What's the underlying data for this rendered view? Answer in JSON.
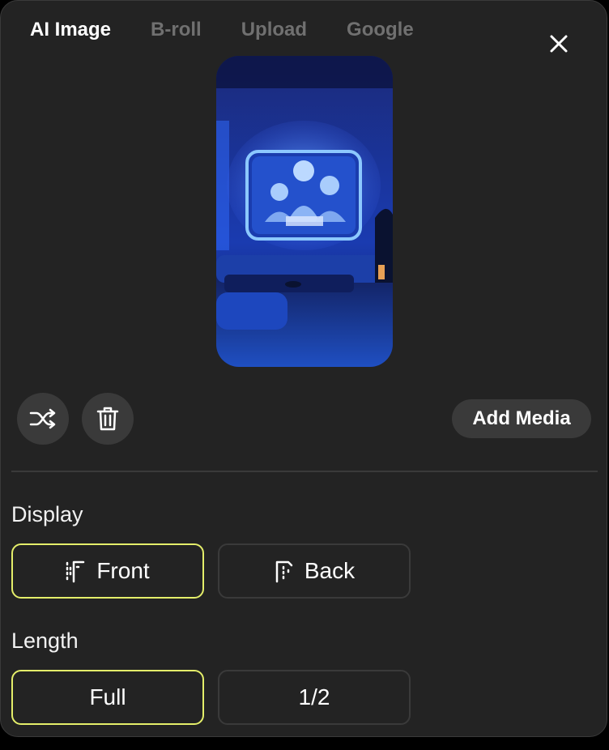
{
  "tabs": [
    {
      "label": "AI Image",
      "active": true
    },
    {
      "label": "B-roll",
      "active": false
    },
    {
      "label": "Upload",
      "active": false
    },
    {
      "label": "Google",
      "active": false
    }
  ],
  "toolbar": {
    "shuffle_icon": "shuffle-icon",
    "delete_icon": "trash-icon",
    "add_media_label": "Add Media"
  },
  "display": {
    "label": "Display",
    "options": [
      {
        "label": "Front",
        "icon": "front-layer-icon",
        "selected": true
      },
      {
        "label": "Back",
        "icon": "back-layer-icon",
        "selected": false
      }
    ]
  },
  "length": {
    "label": "Length",
    "options": [
      {
        "label": "Full",
        "selected": true
      },
      {
        "label": "1/2",
        "selected": false
      }
    ]
  },
  "colors": {
    "panel_bg": "#232323",
    "button_bg": "#3a3a3a",
    "selected_border": "#e4ee6a",
    "inactive_tab": "#707070"
  }
}
